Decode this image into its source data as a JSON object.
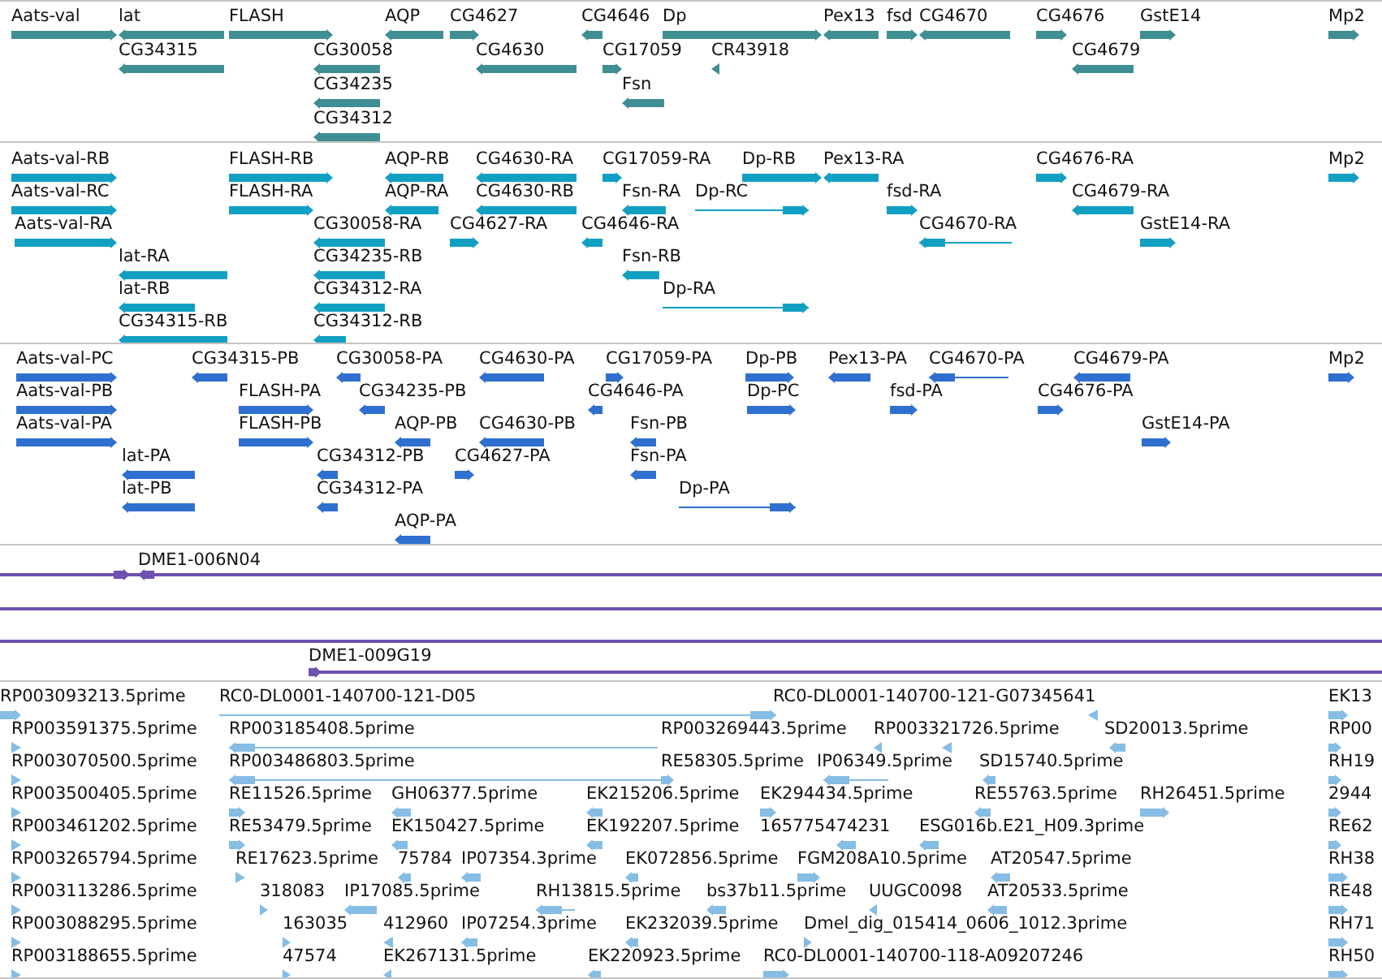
{
  "tracks": [
    {
      "kind": "genes",
      "features": [
        {
          "label": "Aats-val",
          "kind": "forward"
        },
        {
          "label": "lat",
          "kind": "reverse"
        },
        {
          "label": "FLASH",
          "kind": "forward"
        },
        {
          "label": "AQP",
          "kind": "reverse"
        },
        {
          "label": "CG4627",
          "kind": "forward"
        },
        {
          "label": "CG4646",
          "kind": "reverse"
        },
        {
          "label": "Dp",
          "kind": "forward"
        },
        {
          "label": "Pex13",
          "kind": "reverse"
        },
        {
          "label": "fsd",
          "kind": "forward"
        },
        {
          "label": "CG4670",
          "kind": "reverse"
        },
        {
          "label": "CG4676",
          "kind": "forward"
        },
        {
          "label": "GstE14",
          "kind": "forward"
        },
        {
          "label": "Mp2",
          "kind": "forward"
        },
        {
          "label": "CG34315",
          "kind": "reverse"
        },
        {
          "label": "CG30058",
          "kind": "reverse"
        },
        {
          "label": "CG4630",
          "kind": "reverse"
        },
        {
          "label": "CG17059",
          "kind": "forward"
        },
        {
          "label": "CR43918",
          "kind": "reverse"
        },
        {
          "label": "CG4679",
          "kind": "reverse"
        },
        {
          "label": "CG34235",
          "kind": "reverse"
        },
        {
          "label": "Fsn",
          "kind": "reverse"
        },
        {
          "label": "CG34312",
          "kind": "reverse"
        }
      ]
    },
    {
      "kind": "transcripts",
      "features": [
        {
          "label": "Aats-val-RB",
          "kind": "forward"
        },
        {
          "label": "FLASH-RB",
          "kind": "forward"
        },
        {
          "label": "AQP-RB",
          "kind": "reverse"
        },
        {
          "label": "CG4630-RA",
          "kind": "reverse"
        },
        {
          "label": "CG17059-RA",
          "kind": "forward"
        },
        {
          "label": "Dp-RB",
          "kind": "forward"
        },
        {
          "label": "Pex13-RA",
          "kind": "reverse"
        },
        {
          "label": "CG4676-RA",
          "kind": "forward"
        },
        {
          "label": "Mp2",
          "kind": "forward"
        },
        {
          "label": "Aats-val-RC",
          "kind": "forward"
        },
        {
          "label": "FLASH-RA",
          "kind": "forward"
        },
        {
          "label": "AQP-RA",
          "kind": "reverse"
        },
        {
          "label": "CG4630-RB",
          "kind": "reverse"
        },
        {
          "label": "Fsn-RA",
          "kind": "reverse"
        },
        {
          "label": "Dp-RC",
          "kind": "forward"
        },
        {
          "label": "fsd-RA",
          "kind": "forward"
        },
        {
          "label": "CG4679-RA",
          "kind": "reverse"
        },
        {
          "label": "Aats-val-RA",
          "kind": "forward"
        },
        {
          "label": "CG30058-RA",
          "kind": "reverse"
        },
        {
          "label": "CG4627-RA",
          "kind": "forward"
        },
        {
          "label": "CG4646-RA",
          "kind": "reverse"
        },
        {
          "label": "CG4670-RA",
          "kind": "reverse"
        },
        {
          "label": "GstE14-RA",
          "kind": "forward"
        },
        {
          "label": "lat-RA",
          "kind": "reverse"
        },
        {
          "label": "CG34235-RB",
          "kind": "reverse"
        },
        {
          "label": "Fsn-RB",
          "kind": "reverse"
        },
        {
          "label": "lat-RB",
          "kind": "reverse"
        },
        {
          "label": "CG34312-RA",
          "kind": "reverse"
        },
        {
          "label": "Dp-RA",
          "kind": "forward"
        },
        {
          "label": "CG34315-RB",
          "kind": "reverse"
        },
        {
          "label": "CG34312-RB",
          "kind": "reverse"
        }
      ]
    },
    {
      "kind": "proteins",
      "features": [
        {
          "label": "Aats-val-PC",
          "kind": "forward"
        },
        {
          "label": "CG34315-PB",
          "kind": "reverse"
        },
        {
          "label": "CG30058-PA",
          "kind": "reverse"
        },
        {
          "label": "CG4630-PA",
          "kind": "reverse"
        },
        {
          "label": "CG17059-PA",
          "kind": "forward"
        },
        {
          "label": "Dp-PB",
          "kind": "forward"
        },
        {
          "label": "Pex13-PA",
          "kind": "reverse"
        },
        {
          "label": "CG4670-PA",
          "kind": "reverse"
        },
        {
          "label": "CG4679-PA",
          "kind": "reverse"
        },
        {
          "label": "Mp2",
          "kind": "forward"
        },
        {
          "label": "Aats-val-PB",
          "kind": "forward"
        },
        {
          "label": "FLASH-PA",
          "kind": "forward"
        },
        {
          "label": "CG34235-PB",
          "kind": "reverse"
        },
        {
          "label": "CG4646-PA",
          "kind": "reverse"
        },
        {
          "label": "Dp-PC",
          "kind": "forward"
        },
        {
          "label": "fsd-PA",
          "kind": "forward"
        },
        {
          "label": "CG4676-PA",
          "kind": "forward"
        },
        {
          "label": "Aats-val-PA",
          "kind": "forward"
        },
        {
          "label": "FLASH-PB",
          "kind": "forward"
        },
        {
          "label": "AQP-PB",
          "kind": "reverse"
        },
        {
          "label": "CG4630-PB",
          "kind": "reverse"
        },
        {
          "label": "Fsn-PB",
          "kind": "reverse"
        },
        {
          "label": "GstE14-PA",
          "kind": "forward"
        },
        {
          "label": "lat-PA",
          "kind": "reverse"
        },
        {
          "label": "CG34312-PB",
          "kind": "reverse"
        },
        {
          "label": "CG4627-PA",
          "kind": "forward"
        },
        {
          "label": "Fsn-PA",
          "kind": "reverse"
        },
        {
          "label": "lat-PB",
          "kind": "reverse"
        },
        {
          "label": "CG34312-PA",
          "kind": "reverse"
        },
        {
          "label": "Dp-PA",
          "kind": "forward"
        },
        {
          "label": "AQP-PA",
          "kind": "reverse"
        }
      ]
    },
    {
      "kind": "clones",
      "features": [
        {
          "label": "DME1-006N04"
        },
        {
          "label": "DME1-009G19"
        }
      ]
    },
    {
      "kind": "ests",
      "features": [
        {
          "label": "RP003093213.5prime",
          "kind": "forward"
        },
        {
          "label": "RC0-DL0001-140700-121-D05",
          "kind": "forward"
        },
        {
          "label": "RC0-DL0001-140700-121-G07345641",
          "kind": "reverse"
        },
        {
          "label": "EK13",
          "kind": "forward"
        },
        {
          "label": "RP003591375.5prime",
          "kind": "forward"
        },
        {
          "label": "RP003185408.5prime",
          "kind": "reverse"
        },
        {
          "label": "RP003269443.5prime",
          "kind": "reverse"
        },
        {
          "label": "RP003321726.5prime",
          "kind": "reverse"
        },
        {
          "label": "SD20013.5prime",
          "kind": "reverse"
        },
        {
          "label": "RP00",
          "kind": "forward"
        },
        {
          "label": "RP003070500.5prime",
          "kind": "forward"
        },
        {
          "label": "RP003486803.5prime",
          "kind": "reverse"
        },
        {
          "label": "RE58305.5prime",
          "kind": "forward"
        },
        {
          "label": "IP06349.5prime",
          "kind": "reverse"
        },
        {
          "label": "SD15740.5prime",
          "kind": "reverse"
        },
        {
          "label": "RH19",
          "kind": "forward"
        },
        {
          "label": "RP003500405.5prime",
          "kind": "forward"
        },
        {
          "label": "RE11526.5prime",
          "kind": "forward"
        },
        {
          "label": "GH06377.5prime",
          "kind": "reverse"
        },
        {
          "label": "EK215206.5prime",
          "kind": "reverse"
        },
        {
          "label": "EK294434.5prime",
          "kind": "forward"
        },
        {
          "label": "RE55763.5prime",
          "kind": "reverse"
        },
        {
          "label": "RH26451.5prime",
          "kind": "forward"
        },
        {
          "label": "2944",
          "kind": "forward"
        },
        {
          "label": "RP003461202.5prime",
          "kind": "forward"
        },
        {
          "label": "RE53479.5prime",
          "kind": "forward"
        },
        {
          "label": "EK150427.5prime",
          "kind": "reverse"
        },
        {
          "label": "EK192207.5prime",
          "kind": "reverse"
        },
        {
          "label": "165775474231",
          "kind": "reverse"
        },
        {
          "label": "ESG016b.E21_H09.3prime",
          "kind": "reverse"
        },
        {
          "label": "RE62",
          "kind": "forward"
        },
        {
          "label": "RP003265794.5prime",
          "kind": "forward"
        },
        {
          "label": "RE17623.5prime",
          "kind": "forward"
        },
        {
          "label": "75784",
          "kind": "reverse"
        },
        {
          "label": "IP07354.3prime",
          "kind": "reverse"
        },
        {
          "label": "EK072856.5prime",
          "kind": "reverse"
        },
        {
          "label": "FGM208A10.5prime",
          "kind": "forward"
        },
        {
          "label": "AT20547.5prime",
          "kind": "reverse"
        },
        {
          "label": "RH38",
          "kind": "forward"
        },
        {
          "label": "RP003113286.5prime",
          "kind": "forward"
        },
        {
          "label": "318083",
          "kind": "forward"
        },
        {
          "label": "IP17085.5prime",
          "kind": "reverse"
        },
        {
          "label": "RH13815.5prime",
          "kind": "reverse"
        },
        {
          "label": "bs37b11.5prime",
          "kind": "reverse"
        },
        {
          "label": "UUGC0098",
          "kind": "reverse"
        },
        {
          "label": "AT20533.5prime",
          "kind": "reverse"
        },
        {
          "label": "RE48",
          "kind": "forward"
        },
        {
          "label": "RP003088295.5prime",
          "kind": "forward"
        },
        {
          "label": "163035",
          "kind": "forward"
        },
        {
          "label": "412960",
          "kind": "reverse"
        },
        {
          "label": "IP07254.3prime",
          "kind": "reverse"
        },
        {
          "label": "EK232039.5prime",
          "kind": "reverse"
        },
        {
          "label": "Dmel_dig_015414_0606_1012.3prime",
          "kind": "forward"
        },
        {
          "label": "RH71",
          "kind": "forward"
        },
        {
          "label": "RP003188655.5prime",
          "kind": "forward"
        },
        {
          "label": "47574",
          "kind": "forward"
        },
        {
          "label": "EK267131.5prime",
          "kind": "reverse"
        },
        {
          "label": "EK220923.5prime",
          "kind": "reverse"
        },
        {
          "label": "RC0-DL0001-140700-118-A09207246",
          "kind": "forward"
        },
        {
          "label": "RH50",
          "kind": "forward"
        }
      ]
    }
  ]
}
